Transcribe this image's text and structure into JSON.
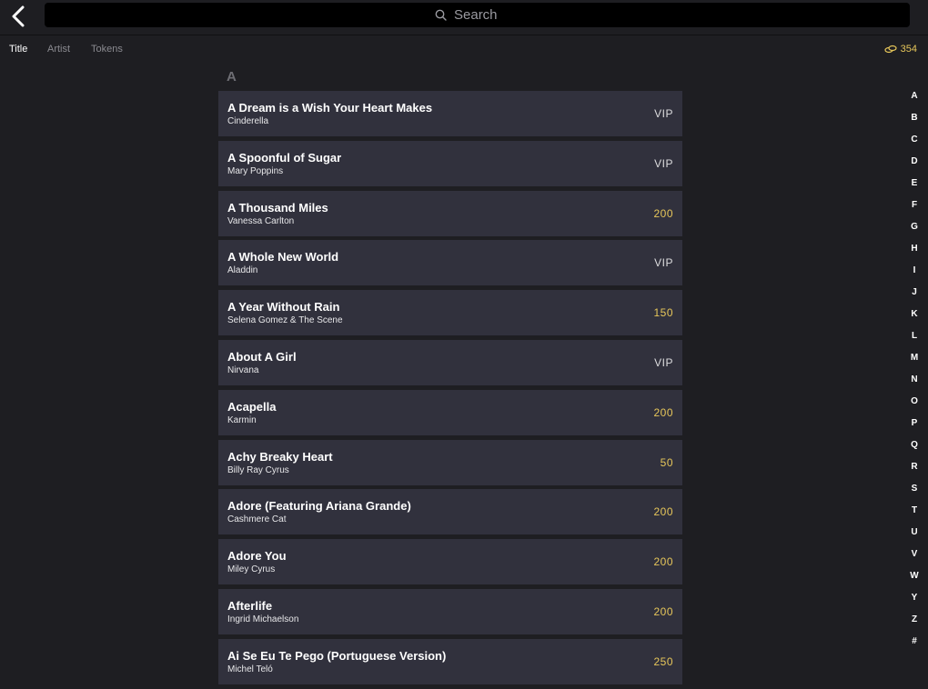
{
  "search": {
    "placeholder": "Search"
  },
  "sort_tabs": [
    {
      "label": "Title",
      "active": true
    },
    {
      "label": "Artist",
      "active": false
    },
    {
      "label": "Tokens",
      "active": false
    }
  ],
  "tokens": {
    "balance": "354",
    "icon": "coins-icon",
    "color": "#e6c65a"
  },
  "section": {
    "letter": "A"
  },
  "songs": [
    {
      "title": "A Dream is a Wish Your Heart Makes",
      "artist": "Cinderella",
      "price": "VIP"
    },
    {
      "title": "A Spoonful of Sugar",
      "artist": "Mary Poppins",
      "price": "VIP"
    },
    {
      "title": "A Thousand Miles",
      "artist": "Vanessa Carlton",
      "price": "200"
    },
    {
      "title": "A Whole New World",
      "artist": "Aladdin",
      "price": "VIP"
    },
    {
      "title": "A Year Without Rain",
      "artist": "Selena Gomez & The Scene",
      "price": "150"
    },
    {
      "title": "About A Girl",
      "artist": "Nirvana",
      "price": "VIP"
    },
    {
      "title": "Acapella",
      "artist": "Karmin",
      "price": "200"
    },
    {
      "title": "Achy Breaky Heart",
      "artist": "Billy Ray Cyrus",
      "price": "50"
    },
    {
      "title": "Adore (Featuring Ariana Grande)",
      "artist": "Cashmere Cat",
      "price": "200"
    },
    {
      "title": "Adore You",
      "artist": "Miley Cyrus",
      "price": "200"
    },
    {
      "title": "Afterlife",
      "artist": "Ingrid Michaelson",
      "price": "200"
    },
    {
      "title": "Ai Se Eu Te Pego (Portuguese Version)",
      "artist": "Michel Teló",
      "price": "250"
    }
  ],
  "alphabet_index": [
    "A",
    "B",
    "C",
    "D",
    "E",
    "F",
    "G",
    "H",
    "I",
    "J",
    "K",
    "L",
    "M",
    "N",
    "O",
    "P",
    "Q",
    "R",
    "S",
    "T",
    "U",
    "V",
    "W",
    "Y",
    "Z",
    "#"
  ],
  "colors": {
    "background": "#1e1e22",
    "row": "#31313d",
    "accent": "#e6c65a"
  }
}
